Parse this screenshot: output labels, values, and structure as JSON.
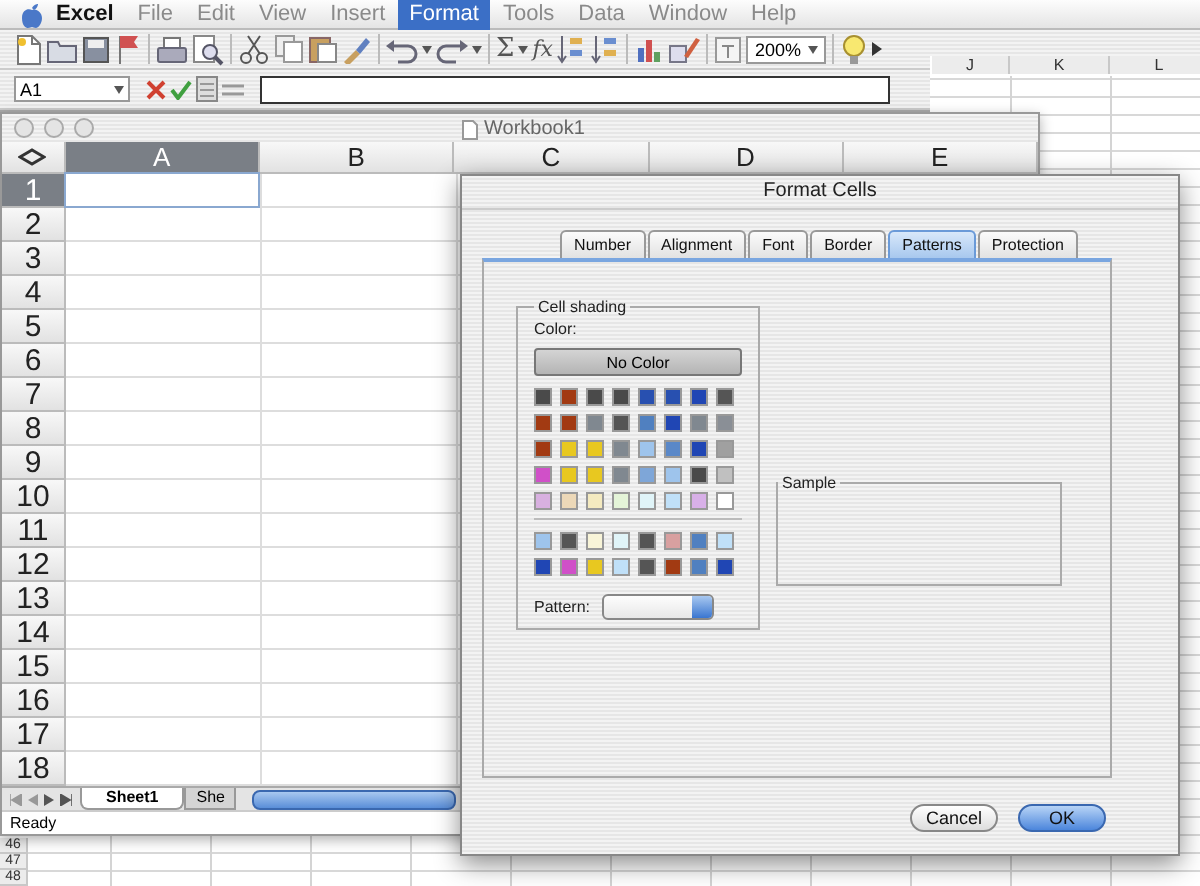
{
  "menu_bar": {
    "items": [
      {
        "label": "Excel",
        "kind": "app",
        "selected": false,
        "disabled": false
      },
      {
        "label": "File",
        "kind": "menu",
        "selected": false,
        "disabled": true
      },
      {
        "label": "Edit",
        "kind": "menu",
        "selected": false,
        "disabled": true
      },
      {
        "label": "View",
        "kind": "menu",
        "selected": false,
        "disabled": true
      },
      {
        "label": "Insert",
        "kind": "menu",
        "selected": false,
        "disabled": true
      },
      {
        "label": "Format",
        "kind": "menu",
        "selected": true,
        "disabled": false
      },
      {
        "label": "Tools",
        "kind": "menu",
        "selected": false,
        "disabled": true
      },
      {
        "label": "Data",
        "kind": "menu",
        "selected": false,
        "disabled": true
      },
      {
        "label": "Window",
        "kind": "menu",
        "selected": false,
        "disabled": true
      },
      {
        "label": "Help",
        "kind": "menu",
        "selected": false,
        "disabled": true
      }
    ]
  },
  "toolbar": {
    "sum_symbol": "Σ",
    "function_symbol": "fx",
    "zoom": "200%"
  },
  "formula_bar": {
    "name_box": "A1"
  },
  "background_sheet": {
    "columns": [
      "J",
      "K",
      "L"
    ],
    "rows": [
      "46",
      "47",
      "48"
    ]
  },
  "workbook": {
    "title": "Workbook1",
    "columns": [
      {
        "label": "A",
        "selected": true
      },
      {
        "label": "B",
        "selected": false
      },
      {
        "label": "C",
        "selected": false
      },
      {
        "label": "D",
        "selected": false
      },
      {
        "label": "E",
        "selected": false
      }
    ],
    "rows": [
      {
        "label": "1",
        "selected": true
      },
      {
        "label": "2",
        "selected": false
      },
      {
        "label": "3",
        "selected": false
      },
      {
        "label": "4",
        "selected": false
      },
      {
        "label": "5",
        "selected": false
      },
      {
        "label": "6",
        "selected": false
      },
      {
        "label": "7",
        "selected": false
      },
      {
        "label": "8",
        "selected": false
      },
      {
        "label": "9",
        "selected": false
      },
      {
        "label": "10",
        "selected": false
      },
      {
        "label": "11",
        "selected": false
      },
      {
        "label": "12",
        "selected": false
      },
      {
        "label": "13",
        "selected": false
      },
      {
        "label": "14",
        "selected": false
      },
      {
        "label": "15",
        "selected": false
      },
      {
        "label": "16",
        "selected": false
      },
      {
        "label": "17",
        "selected": false
      },
      {
        "label": "18",
        "selected": false
      }
    ],
    "sheet_tabs": [
      {
        "label": "Sheet1",
        "selected": true
      },
      {
        "label": "She",
        "selected": false
      }
    ],
    "status": "Ready"
  },
  "dialog": {
    "title": "Format Cells",
    "tabs": [
      {
        "label": "Number",
        "selected": false
      },
      {
        "label": "Alignment",
        "selected": false
      },
      {
        "label": "Font",
        "selected": false
      },
      {
        "label": "Border",
        "selected": false
      },
      {
        "label": "Patterns",
        "selected": true
      },
      {
        "label": "Protection",
        "selected": false
      }
    ],
    "cell_shading": {
      "title": "Cell shading",
      "color_label": "Color:",
      "no_color_button": "No Color",
      "swatch_rows": [
        {
          "swatches": [
            {
              "color": "#4a4a4a"
            },
            {
              "color": "#a23a12"
            },
            {
              "color": "#4a4a4a"
            },
            {
              "color": "#4a4a4a"
            },
            {
              "color": "#2850b0"
            },
            {
              "color": "#2850b0"
            },
            {
              "color": "#2046b4"
            },
            {
              "color": "#555555"
            }
          ]
        },
        {
          "swatches": [
            {
              "color": "#a23a12"
            },
            {
              "color": "#a23a12"
            },
            {
              "color": "#808890"
            },
            {
              "color": "#555555"
            },
            {
              "color": "#5080c0"
            },
            {
              "color": "#2046b4"
            },
            {
              "color": "#808890"
            },
            {
              "color": "#8a8f96"
            }
          ]
        },
        {
          "swatches": [
            {
              "color": "#a23a12"
            },
            {
              "color": "#e8c820"
            },
            {
              "color": "#e8c820"
            },
            {
              "color": "#808890"
            },
            {
              "color": "#9ec4ec"
            },
            {
              "color": "#5a88c8"
            },
            {
              "color": "#2046b4"
            },
            {
              "color": "#a0a0a0"
            }
          ]
        },
        {
          "swatches": [
            {
              "color": "#d050c8"
            },
            {
              "color": "#e8c820"
            },
            {
              "color": "#e8c820"
            },
            {
              "color": "#808890"
            },
            {
              "color": "#7ea6d8"
            },
            {
              "color": "#9ec4ec"
            },
            {
              "color": "#4a4a4a"
            },
            {
              "color": "#c0c0c0"
            }
          ]
        },
        {
          "swatches": [
            {
              "color": "#d8b0e0"
            },
            {
              "color": "#ecd8b8"
            },
            {
              "color": "#f4eac0"
            },
            {
              "color": "#e4f4d8"
            },
            {
              "color": "#e0f4f8"
            },
            {
              "color": "#c0e0f8"
            },
            {
              "color": "#d8b0e8"
            },
            {
              "color": "#ffffff"
            }
          ]
        }
      ],
      "extra_swatch_rows": [
        {
          "swatches": [
            {
              "color": "#9ec4ec"
            },
            {
              "color": "#555555"
            },
            {
              "color": "#f8f4d8"
            },
            {
              "color": "#e0f4f8"
            },
            {
              "color": "#555555"
            },
            {
              "color": "#d8a0a0"
            },
            {
              "color": "#5080c0"
            },
            {
              "color": "#c0e0f8"
            }
          ]
        },
        {
          "swatches": [
            {
              "color": "#2046b4"
            },
            {
              "color": "#d050c8"
            },
            {
              "color": "#e8c820"
            },
            {
              "color": "#c0e0f8"
            },
            {
              "color": "#555555"
            },
            {
              "color": "#a23a12"
            },
            {
              "color": "#5080c0"
            },
            {
              "color": "#2046b4"
            }
          ]
        }
      ],
      "pattern_label": "Pattern:"
    },
    "sample": {
      "title": "Sample"
    },
    "buttons": [
      {
        "label": "Cancel",
        "default": false
      },
      {
        "label": "OK",
        "default": true
      }
    ]
  }
}
